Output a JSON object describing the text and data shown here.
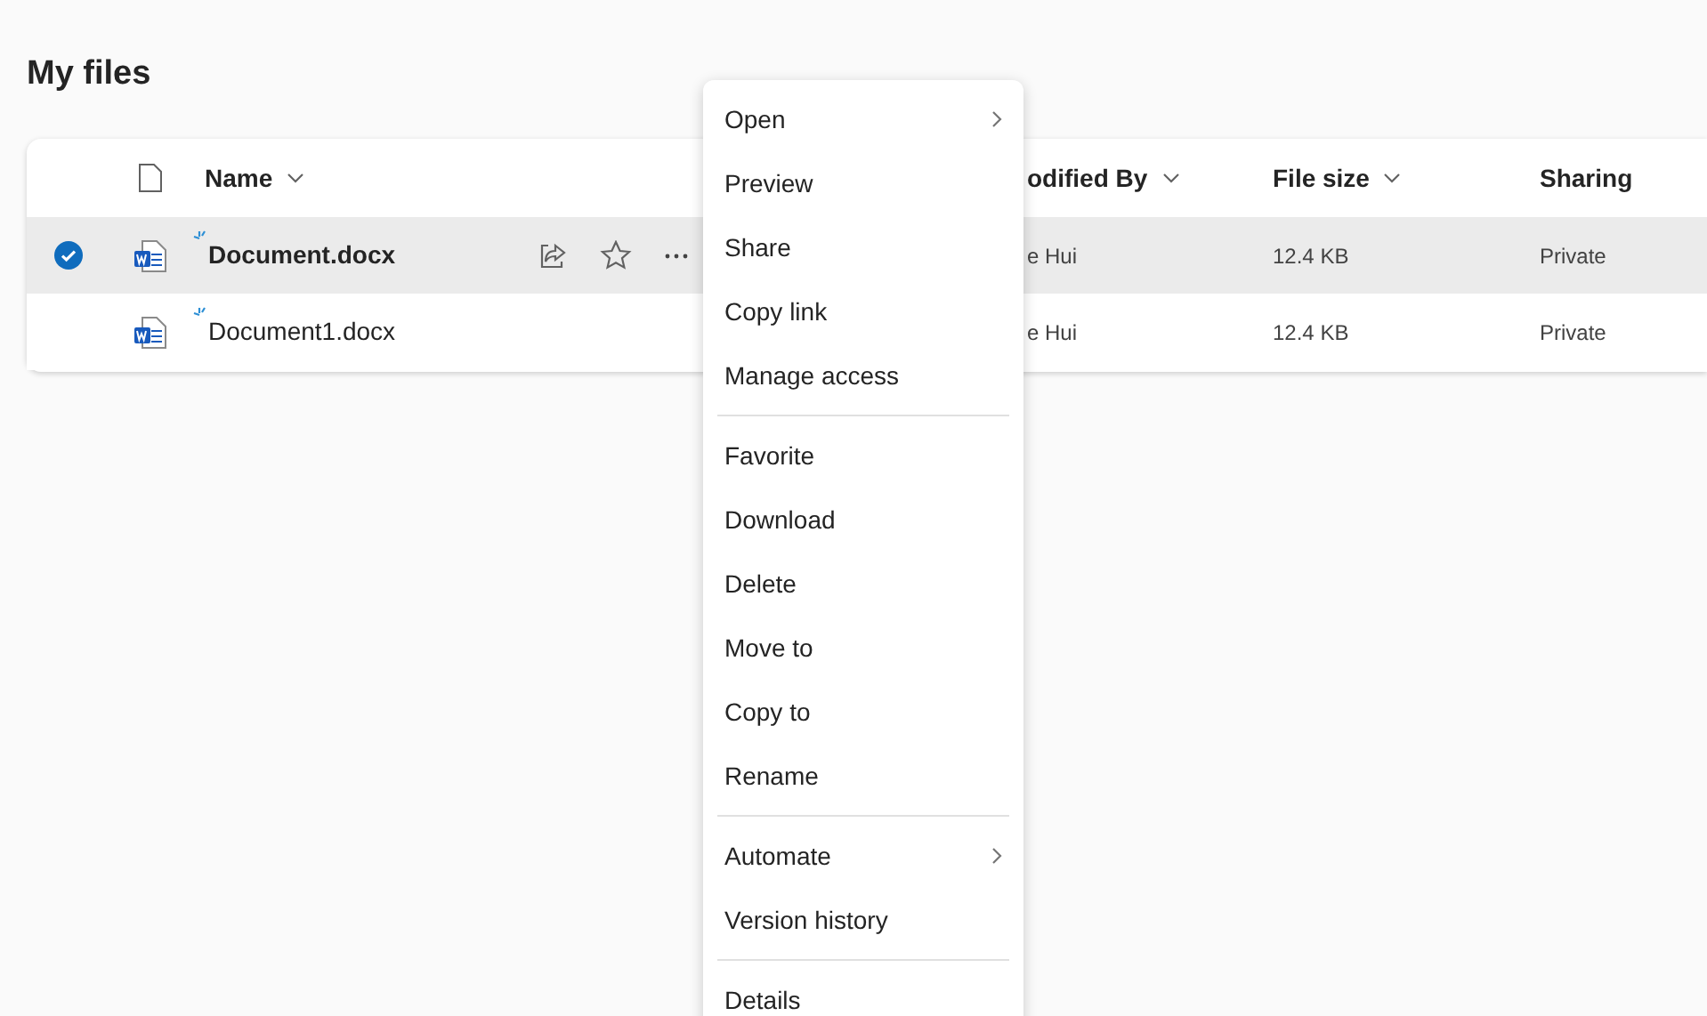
{
  "page_title": "My files",
  "columns": [
    {
      "label": "Name",
      "sortable": true
    },
    {
      "label": "odified By",
      "sortable": true
    },
    {
      "label": "File size",
      "sortable": true
    },
    {
      "label": "Sharing",
      "sortable": false
    }
  ],
  "rows": [
    {
      "name": "Document.docx",
      "modified_by": "e Hui",
      "file_size": "12.4 KB",
      "sharing": "Private",
      "selected": true
    },
    {
      "name": "Document1.docx",
      "modified_by": "e Hui",
      "file_size": "12.4 KB",
      "sharing": "Private",
      "selected": false
    }
  ],
  "context_menu": {
    "groups": [
      [
        {
          "label": "Open",
          "submenu": true
        },
        {
          "label": "Preview",
          "submenu": false
        },
        {
          "label": "Share",
          "submenu": false
        },
        {
          "label": "Copy link",
          "submenu": false
        },
        {
          "label": "Manage access",
          "submenu": false
        }
      ],
      [
        {
          "label": "Favorite",
          "submenu": false
        },
        {
          "label": "Download",
          "submenu": false
        },
        {
          "label": "Delete",
          "submenu": false
        },
        {
          "label": "Move to",
          "submenu": false
        },
        {
          "label": "Copy to",
          "submenu": false
        },
        {
          "label": "Rename",
          "submenu": false
        }
      ],
      [
        {
          "label": "Automate",
          "submenu": true
        },
        {
          "label": "Version history",
          "submenu": false
        }
      ],
      [
        {
          "label": "Details",
          "submenu": false
        }
      ]
    ]
  }
}
